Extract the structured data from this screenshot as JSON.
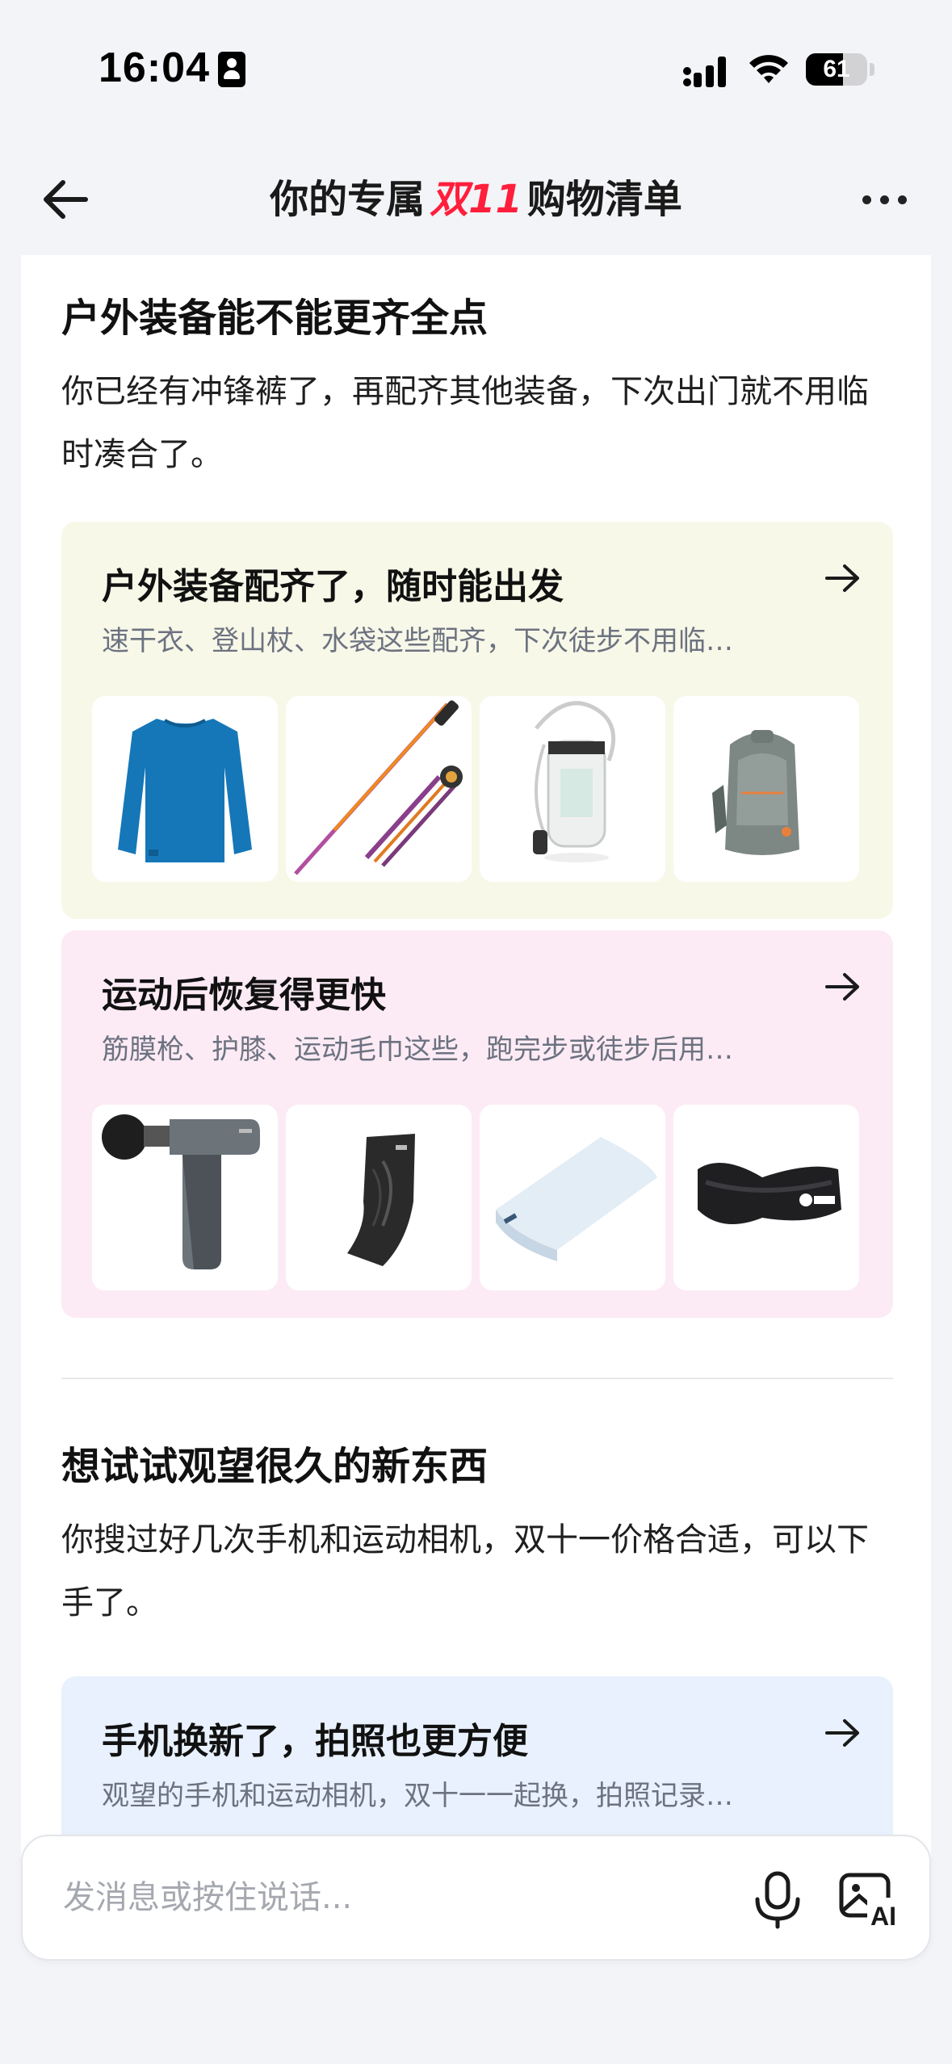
{
  "status_bar": {
    "time": "16:04",
    "battery": "61",
    "battery_level": 0.61
  },
  "header": {
    "title_before": "你的专属",
    "title_accent": "双11",
    "title_after": "购物清单",
    "back_icon": "arrow-left-icon",
    "more_icon": "more-horizontal-icon"
  },
  "sections": [
    {
      "title": "户外装备能不能更齐全点",
      "description": "你已经有冲锋裤了，再配齐其他装备，下次出门就不用临时凑合了。",
      "cards": [
        {
          "title": "户外装备配齐了，随时能出发",
          "subtitle": "速干衣、登山杖、水袋这些配齐，下次徒步不用临…",
          "products": [
            "blue-quick-dry-shirt",
            "trekking-poles",
            "hydration-bladder",
            "gray-backpack"
          ]
        },
        {
          "title": "运动后恢复得更快",
          "subtitle": "筋膜枪、护膝、运动毛巾这些，跑完步或徒步后用…",
          "products": [
            "massage-gun",
            "knee-brace",
            "sports-towel",
            "waist-belt"
          ]
        }
      ]
    },
    {
      "title": "想试试观望很久的新东西",
      "description": "你搜过好几次手机和运动相机，双十一价格合适，可以下手了。",
      "cards": [
        {
          "title": "手机换新了，拍照也更方便",
          "subtitle": "观望的手机和运动相机，双十一一起换，拍照记录…"
        }
      ]
    }
  ],
  "input_bar": {
    "placeholder": "发消息或按住说话...",
    "mic_icon": "microphone-icon",
    "ai_image_icon": "ai-image-icon"
  },
  "colors": {
    "accent": "#ff1f3c",
    "card_yellow": "#f7f8e8",
    "card_pink": "#fcebf5",
    "card_blue": "#e8f1fd",
    "page_bg": "#f3f4f7"
  }
}
